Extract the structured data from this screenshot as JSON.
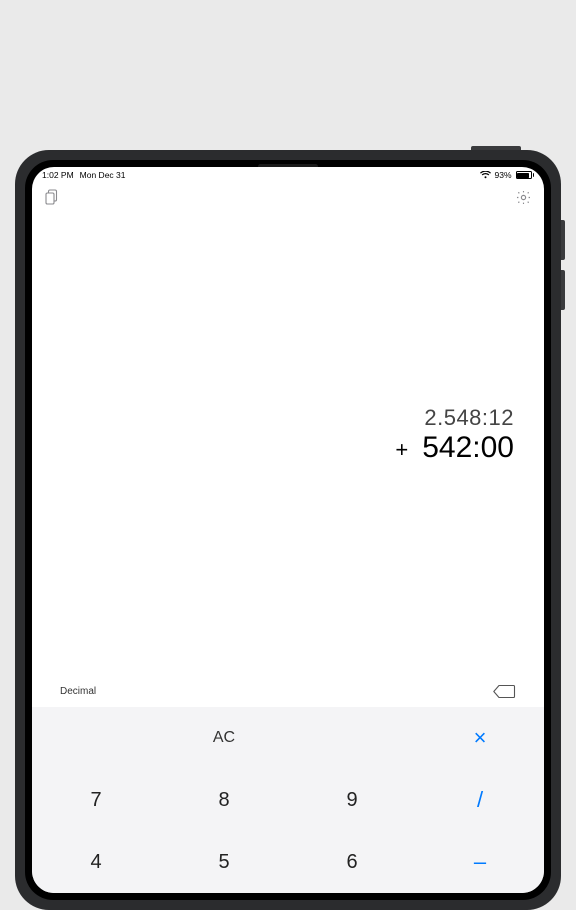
{
  "status": {
    "time": "1:02 PM",
    "date": "Mon Dec 31",
    "battery_pct": "93%"
  },
  "display": {
    "line1": "2.548:12",
    "operator": "+",
    "line2": "542:00"
  },
  "mode": {
    "label": "Decimal"
  },
  "keys": {
    "ac": "AC",
    "mult": "×",
    "k7": "7",
    "k8": "8",
    "k9": "9",
    "div": "/",
    "k4": "4",
    "k5": "5",
    "k6": "6",
    "minus": "–"
  }
}
